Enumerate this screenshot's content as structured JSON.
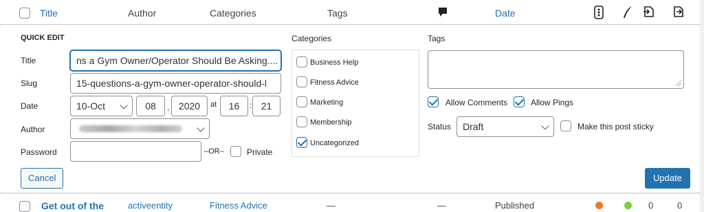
{
  "header": {
    "title": "Title",
    "author": "Author",
    "categories": "Categories",
    "tags": "Tags",
    "date": "Date"
  },
  "quick_edit": {
    "heading": "QUICK EDIT",
    "title_label": "Title",
    "title_value": "ns a Gym Owner/Operator Should Be Asking....",
    "slug_label": "Slug",
    "slug_value": "15-questions-a-gym-owner-operator-should-l",
    "date_label": "Date",
    "date_month": "10-Oct",
    "date_day": "08",
    "date_year": "2020",
    "at_label": "at",
    "date_hour": "16",
    "colon_label": ":",
    "date_minute": "21",
    "author_label": "Author",
    "password_label": "Password",
    "password_value": "",
    "or_label": "–OR–",
    "private_label": "Private",
    "categories_label": "Categories",
    "categories": [
      {
        "label": "Business Help",
        "checked": false
      },
      {
        "label": "Fitness Advice",
        "checked": false
      },
      {
        "label": "Marketing",
        "checked": false
      },
      {
        "label": "Membership",
        "checked": false
      },
      {
        "label": "Uncategorized",
        "checked": true
      }
    ],
    "tags_label": "Tags",
    "allow_comments_label": "Allow Comments",
    "allow_comments_checked": true,
    "allow_pings_label": "Allow Pings",
    "allow_pings_checked": true,
    "status_label": "Status",
    "status_value": "Draft",
    "sticky_label": "Make this post sticky",
    "cancel_label": "Cancel",
    "update_label": "Update"
  },
  "row": {
    "title": "Get out of the",
    "author": "activeentity",
    "categories": "Fitness Advice",
    "tags": "—",
    "comments": "—",
    "status": "Published",
    "count_a": "0",
    "count_b": "0"
  },
  "colors": {
    "link": "#2271b1",
    "seo_dot": "#f0782a",
    "readability_dot": "#7ad03a"
  }
}
